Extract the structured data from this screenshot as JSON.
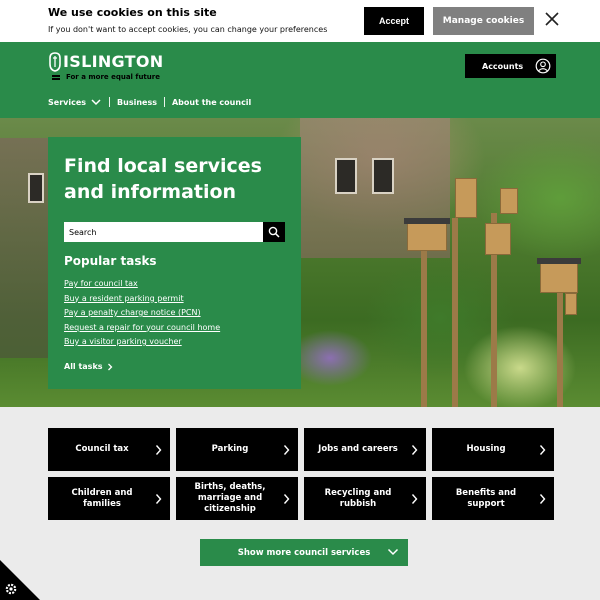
{
  "cookie_banner": {
    "title": "We use cookies on this site",
    "text": "If you don't want to accept cookies, you can change your preferences",
    "accept_label": "Accept",
    "manage_label": "Manage cookies",
    "close_icon": "close-icon"
  },
  "header": {
    "logo_word": "ISLINGTON",
    "logo_tagline": "For a more equal future",
    "accounts_label": "Accounts",
    "accounts_icon": "user-icon",
    "nav": [
      {
        "label": "Services"
      },
      {
        "label": "Business"
      },
      {
        "label": "About the council"
      }
    ]
  },
  "hero": {
    "title": "Find local services and information",
    "search_placeholder": "Search",
    "popular_title": "Popular tasks",
    "tasks": [
      "Pay for council tax",
      "Buy a resident parking permit",
      "Pay a penalty charge notice (PCN)",
      "Request a repair for your council home",
      "Buy a visitor parking voucher"
    ],
    "all_tasks_label": "All tasks"
  },
  "services": [
    "Council tax",
    "Parking",
    "Jobs and careers",
    "Housing",
    "Children and families",
    "Births, deaths, marriage and citizenship",
    "Recycling and rubbish",
    "Benefits and support"
  ],
  "show_more_label": "Show more council services",
  "colors": {
    "brand_green": "#2a8b4a",
    "black": "#000000",
    "grey_button": "#808080"
  }
}
